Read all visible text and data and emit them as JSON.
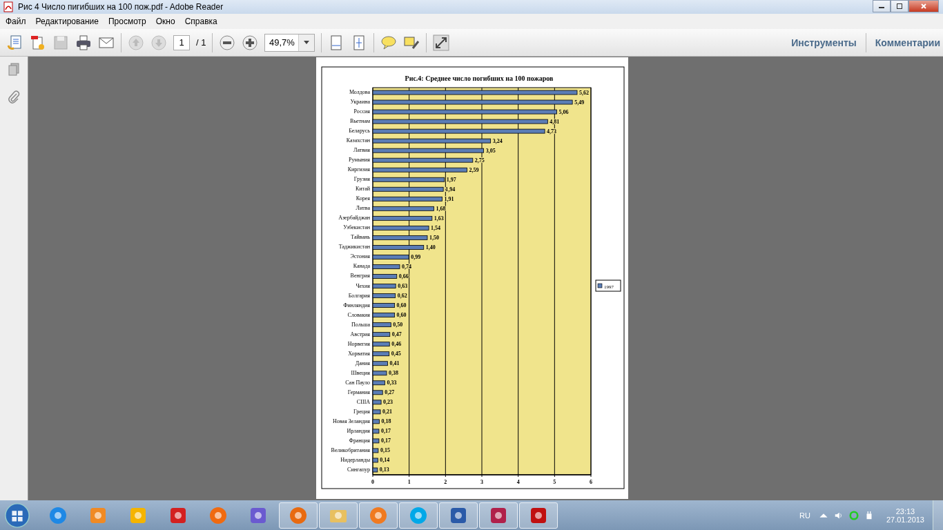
{
  "window": {
    "title": "Рис 4 Число пигибших на 100 пож.pdf - Adobe Reader"
  },
  "menu": [
    "Файл",
    "Редактирование",
    "Просмотр",
    "Окно",
    "Справка"
  ],
  "toolbar": {
    "page_number": "1",
    "page_total": "/ 1",
    "zoom": "49,7%",
    "right_buttons": [
      "Инструменты",
      "Комментарии"
    ]
  },
  "document": {
    "chart_data": {
      "type": "bar",
      "orientation": "horizontal",
      "title": "Рис.4: Среднее число погибших на 100 пожаров",
      "categories": [
        "Молдова",
        "Украина",
        "Россия",
        "Вьетнам",
        "Беларусь",
        "Казахстан",
        "Латвия",
        "Румыния",
        "Киргизия",
        "Грузия",
        "Китай",
        "Корея",
        "Литва",
        "Азербайджан",
        "Узбекистан",
        "Тайвань",
        "Таджикистан",
        "Эстония",
        "Канада",
        "Венгрия",
        "Чехия",
        "Болгария",
        "Финляндия",
        "Словакия",
        "Польша",
        "Австрия",
        "Норвегия",
        "Хорватия",
        "Дания",
        "Швеция",
        "Сан Пауло",
        "Германия",
        "США",
        "Греция",
        "Новая Зеландия",
        "Ирландия",
        "Франция",
        "Великобритания",
        "Нидерланды",
        "Сингапур"
      ],
      "series": [
        {
          "name": "1997",
          "color": "#5b7db5",
          "values": [
            5.62,
            5.49,
            5.06,
            4.81,
            4.73,
            3.24,
            3.05,
            2.75,
            2.59,
            1.97,
            1.94,
            1.91,
            1.68,
            1.63,
            1.54,
            1.5,
            1.4,
            0.99,
            0.74,
            0.66,
            0.63,
            0.62,
            0.6,
            0.6,
            0.5,
            0.47,
            0.46,
            0.45,
            0.41,
            0.38,
            0.33,
            0.27,
            0.23,
            0.21,
            0.18,
            0.17,
            0.17,
            0.15,
            0.14,
            0.13
          ]
        }
      ],
      "value_labels": [
        "5,62",
        "5,49",
        "5,06",
        "4,81",
        "4,73",
        "3,24",
        "3,05",
        "2,75",
        "2,59",
        "1,97",
        "1,94",
        "1,91",
        "1,68",
        "1,63",
        "1,54",
        "1,50",
        "1,40",
        "0,99",
        "0,74",
        "0,66",
        "0,63",
        "0,62",
        "0,60",
        "0,60",
        "0,50",
        "0,47",
        "0,46",
        "0,45",
        "0,41",
        "0,38",
        "0,33",
        "0,27",
        "0,23",
        "0,21",
        "0,18",
        "0,17",
        "0,17",
        "0,15",
        "0,14",
        "0,13"
      ],
      "grid": true,
      "xlim": [
        0,
        6
      ],
      "xticks": [
        0,
        1,
        2,
        3,
        4,
        5,
        6
      ]
    }
  },
  "taskbar": {
    "items": [
      {
        "kind": "ie",
        "running": false
      },
      {
        "kind": "media",
        "running": false
      },
      {
        "kind": "d",
        "running": false
      },
      {
        "kind": "m",
        "running": false
      },
      {
        "kind": "flame",
        "running": false
      },
      {
        "kind": "floppy",
        "running": false
      },
      {
        "kind": "firefox",
        "running": true
      },
      {
        "kind": "folder",
        "running": true
      },
      {
        "kind": "at",
        "running": true
      },
      {
        "kind": "skype",
        "running": true
      },
      {
        "kind": "word",
        "running": true
      },
      {
        "kind": "access",
        "running": true
      },
      {
        "kind": "acrobat",
        "running": true
      }
    ],
    "language": "RU",
    "time": "23:13",
    "date": "27.01.2013"
  }
}
